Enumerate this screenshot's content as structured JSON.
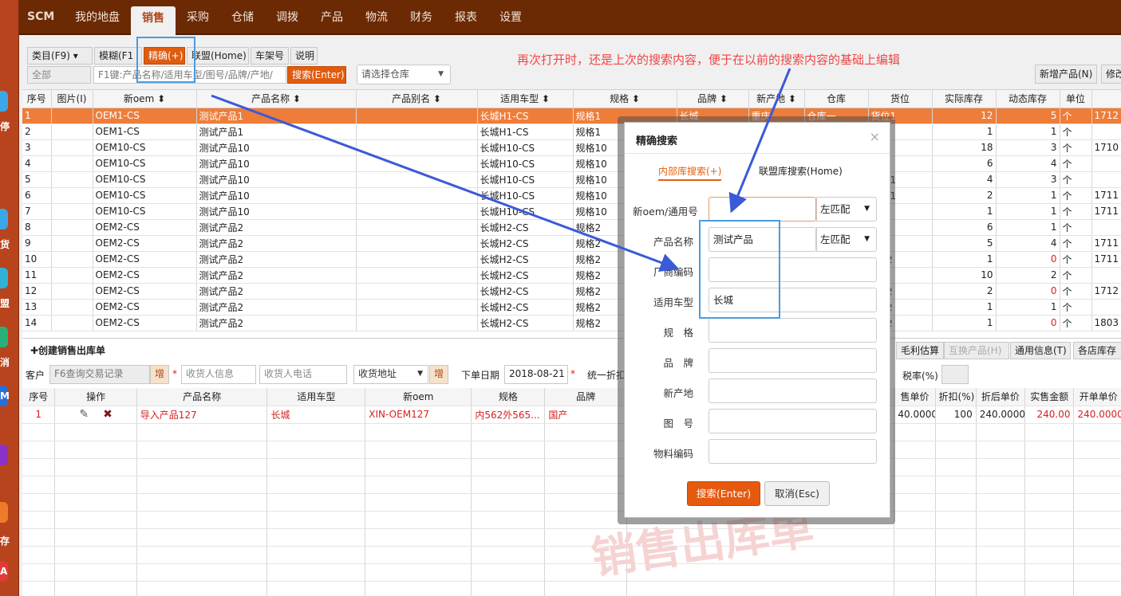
{
  "app": {
    "brand": "SCM"
  },
  "nav": [
    "我的地盘",
    "销售",
    "采购",
    "仓储",
    "调拨",
    "产品",
    "物流",
    "财务",
    "报表",
    "设置"
  ],
  "nav_active": 1,
  "leftbar": [
    "停",
    "货",
    "盟",
    "消",
    "M",
    "存",
    "A"
  ],
  "toolbar": {
    "category": "类目(F9) ▾",
    "fuzzy": "模糊(F1",
    "exact": "精确(+)",
    "union": "联盟(Home)",
    "shelf": "车架号",
    "help": "说明",
    "all": "全部",
    "search_placeholder": "F1键:产品名称/适用车型/图号/品牌/产地/",
    "search_btn": "搜索(Enter)",
    "warehouse": "请选择仓库",
    "new_product": "新增产品(N)",
    "modify": "修改"
  },
  "annotation": "再次打开时，还是上次的搜索内容，便于在以前的搜索内容的基础上编辑",
  "grid": {
    "headers": [
      "序号",
      "图片(I)",
      "新oem ⬍",
      "产品名称 ⬍",
      "产品别名 ⬍",
      "适用车型 ⬍",
      "规格 ⬍",
      "品牌 ⬍",
      "新产地 ⬍",
      "仓库",
      "货位",
      "实际库存",
      "动态库存",
      "单位",
      ""
    ],
    "rows": [
      [
        "1",
        "",
        "OEM1-CS",
        "测试产品1",
        "",
        "长城H1-CS",
        "规格1",
        "长城",
        "重庆",
        "仓库一",
        "货位1",
        "12",
        "5",
        "个",
        "1712"
      ],
      [
        "2",
        "",
        "OEM1-CS",
        "测试产品1",
        "",
        "长城H1-CS",
        "规格1",
        "",
        "",
        "",
        "立1",
        "1",
        "1",
        "个",
        ""
      ],
      [
        "3",
        "",
        "OEM10-CS",
        "测试产品10",
        "",
        "长城H10-CS",
        "规格10",
        "",
        "",
        "",
        "01A",
        "18",
        "3",
        "个",
        "1710"
      ],
      [
        "4",
        "",
        "OEM10-CS",
        "测试产品10",
        "",
        "长城H10-CS",
        "规格10",
        "",
        "",
        "",
        "34",
        "6",
        "4",
        "个",
        ""
      ],
      [
        "5",
        "",
        "OEM10-CS",
        "测试产品10",
        "",
        "长城H10-CS",
        "规格10",
        "",
        "",
        "",
        "货位1",
        "4",
        "3",
        "个",
        ""
      ],
      [
        "6",
        "",
        "OEM10-CS",
        "测试产品10",
        "",
        "长城H10-CS",
        "规格10",
        "",
        "",
        "",
        "货位1",
        "2",
        "1",
        "个",
        "1711"
      ],
      [
        "7",
        "",
        "OEM10-CS",
        "测试产品10",
        "",
        "长城H10-CS",
        "规格10",
        "",
        "",
        "",
        "34",
        "1",
        "1",
        "个",
        "1711"
      ],
      [
        "8",
        "",
        "OEM2-CS",
        "测试产品2",
        "",
        "长城H2-CS",
        "规格2",
        "",
        "",
        "",
        "立1",
        "6",
        "1",
        "个",
        ""
      ],
      [
        "9",
        "",
        "OEM2-CS",
        "测试产品2",
        "",
        "长城H2-CS",
        "规格2",
        "",
        "",
        "",
        "立1",
        "5",
        "4",
        "个",
        "1711"
      ],
      [
        "10",
        "",
        "OEM2-CS",
        "测试产品2",
        "",
        "长城H2-CS",
        "规格2",
        "",
        "",
        "",
        "立12",
        "1",
        "0",
        "个",
        "1711"
      ],
      [
        "11",
        "",
        "OEM2-CS",
        "测试产品2",
        "",
        "长城H2-CS",
        "规格2",
        "",
        "",
        "",
        "01A",
        "10",
        "2",
        "个",
        ""
      ],
      [
        "12",
        "",
        "OEM2-CS",
        "测试产品2",
        "",
        "长城H2-CS",
        "规格2",
        "",
        "",
        "",
        "立12",
        "2",
        "0",
        "个",
        "1712"
      ],
      [
        "13",
        "",
        "OEM2-CS",
        "测试产品2",
        "",
        "长城H2-CS",
        "规格2",
        "",
        "",
        "",
        "立12",
        "1",
        "1",
        "个",
        ""
      ],
      [
        "14",
        "",
        "OEM2-CS",
        "测试产品2",
        "",
        "长城H2-CS",
        "规格2",
        "",
        "",
        "",
        "立12",
        "1",
        "0",
        "个",
        "1803"
      ]
    ]
  },
  "order": {
    "title": "✚创建销售出库单",
    "customer_label": "客户",
    "customer_placeholder": "F6查询交易记录",
    "add": "增",
    "receiver_placeholder": "收货人信息",
    "phone_placeholder": "收货人电话",
    "address": "收货地址",
    "date_label": "下单日期",
    "date": "2018-08-21",
    "discount_label": "统一折扣",
    "profit": "毛利估算",
    "swap": "互换产品(H)",
    "general": "通用信息(T)",
    "stores": "各店库存",
    "tax_label": "税率(%)",
    "headers": [
      "序号",
      "操作",
      "产品名称",
      "适用车型",
      "新oem",
      "规格",
      "品牌",
      "",
      "售单价",
      "折扣(%)",
      "折后单价",
      "实售金额",
      "开单单价"
    ],
    "row": [
      "1",
      "",
      "导入产品127",
      "长城",
      "XIN-OEM127",
      "内562外565...",
      "国产",
      "",
      "40.0000",
      "100",
      "240.0000",
      "240.00",
      "240.0000"
    ]
  },
  "watermark": "销售出库单",
  "modal": {
    "title": "精确搜索",
    "close": "×",
    "tabs": [
      "内部库搜索(+)",
      "联盟库搜索(Home)"
    ],
    "fields": [
      {
        "label": "新oem/通用号",
        "value": "",
        "select": "左匹配"
      },
      {
        "label": "产品名称",
        "value": "测试产品",
        "select": "左匹配"
      },
      {
        "label": "厂商编码",
        "value": ""
      },
      {
        "label": "适用车型",
        "value": "长城"
      },
      {
        "label": "规　格",
        "value": ""
      },
      {
        "label": "品　牌",
        "value": ""
      },
      {
        "label": "新产地",
        "value": ""
      },
      {
        "label": "图　号",
        "value": ""
      },
      {
        "label": "物料编码",
        "value": ""
      }
    ],
    "search_btn": "搜索(Enter)",
    "cancel_btn": "取消(Esc)"
  },
  "colors": {
    "accent": "#e15b0f",
    "topbar": "#6b2a04",
    "annotation": "#f04545",
    "highlight_box": "#4a9be2",
    "arrow": "#3b5ad6"
  }
}
